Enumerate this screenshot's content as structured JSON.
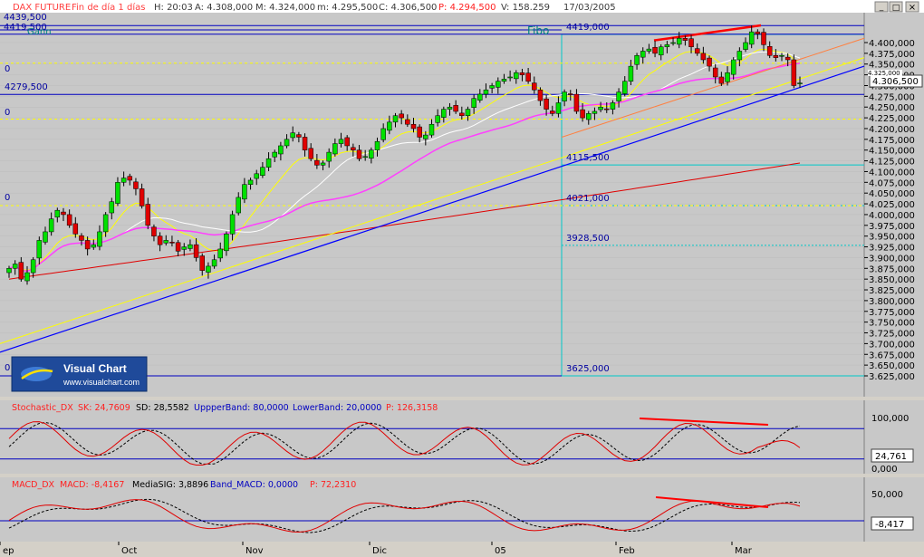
{
  "header": {
    "name": "DAX FUTURE",
    "period": "Fin de día 1 días",
    "H": "H: 20:03",
    "A": "A: 4.308,000",
    "M": "M: 4.324,000",
    "m": "m: 4.295,500",
    "C": "C: 4.306,500",
    "P": "P: 4.294,500",
    "V": "V: 158.259",
    "date": "17/03/2005"
  },
  "window_controls": {
    "minimize": "_",
    "restore": "□",
    "close": "×"
  },
  "logo": {
    "title": "Visual Chart",
    "url": "www.visualchart.com"
  },
  "gann_label": "Gann",
  "fibo_label": "Fibo",
  "price_axis": {
    "ticks": [
      "4.400,000",
      "4.375,000",
      "4.350,000",
      "4.325,000",
      "4.300,000",
      "4.275,000",
      "4.250,000",
      "4.225,000",
      "4.200,000",
      "4.175,000",
      "4.150,000",
      "4.125,000",
      "4.100,000",
      "4.075,000",
      "4.050,000",
      "4.025,000",
      "4.000,000",
      "3.975,000",
      "3.950,000",
      "3.925,000",
      "3.900,000",
      "3.875,000",
      "3.850,000",
      "3.825,000",
      "3.800,000",
      "3.775,000",
      "3.750,000",
      "3.725,000",
      "3.700,000",
      "3.675,000",
      "3.650,000",
      "3.625,000"
    ],
    "current_price": "4.306,500",
    "covered_label": "4.325,000"
  },
  "left_levels": [
    "4439,500",
    "4419,500",
    "4279,500"
  ],
  "left_clipped": [
    "0",
    "0",
    "0",
    "0"
  ],
  "fib_labels": [
    "4419,000",
    "4115,500",
    "4021,000",
    "3928,500",
    "3625,000"
  ],
  "stochastic": {
    "header": {
      "name": "Stochastic_DX",
      "SK": "SK: 24,7609",
      "SD": "SD: 28,5582",
      "upper": "UppperBand: 80,0000",
      "lower": "LowerBand: 20,0000",
      "P": "P: 126,3158"
    },
    "axis": [
      "100,000",
      "0,000"
    ],
    "current": "24,761"
  },
  "macd": {
    "header": {
      "name": "MACD_DX",
      "MACD": "MACD: -8,4167",
      "sig": "MediaSIG: 3,8896",
      "band": "Band_MACD: 0,0000",
      "P": "P: 72,2310"
    },
    "axis_top": "50,000",
    "current": "-8,417"
  },
  "x_axis": [
    "ep",
    "Oct",
    "Nov",
    "Dic",
    "05",
    "Feb",
    "Mar"
  ],
  "colors": {
    "background": "#c8c8c8",
    "up_candle": "#00e000",
    "down_candle": "#e00000",
    "ma_white": "#ffffff",
    "ma_yellow": "#ffff00",
    "ma_magenta": "#ff40ff",
    "ma_red": "#e00000",
    "trendline": "#0000ff",
    "fib_lines": "#00c8c8"
  },
  "chart_data": {
    "type": "candlestick",
    "title": "DAX FUTURE",
    "x": [
      "Sep",
      "Oct",
      "Nov",
      "Dic",
      "05",
      "Feb",
      "Mar"
    ],
    "ylim": [
      3610,
      4450
    ],
    "series": [
      {
        "values": [
          3875,
          3885,
          3850,
          3865,
          3895,
          3940,
          3960,
          3990,
          4010,
          4000,
          3975,
          3955,
          3940,
          3920,
          3930,
          3960,
          4000,
          4030,
          4075,
          4085,
          4080,
          4060,
          4020,
          3975,
          3950,
          3930,
          3940,
          3935,
          3915,
          3925,
          3930,
          3900,
          3870,
          3880,
          3895,
          3920,
          3955,
          4000,
          4040,
          4070,
          4080,
          4095,
          4110,
          4130,
          4145,
          4160,
          4175,
          4190,
          4180,
          4150,
          4130,
          4115,
          4120,
          4145,
          4165,
          4175,
          4160,
          4150,
          4130,
          4135,
          4150,
          4170,
          4200,
          4215,
          4230,
          4225,
          4210,
          4200,
          4180,
          4185,
          4210,
          4230,
          4245,
          4250,
          4240,
          4230,
          4245,
          4270,
          4280,
          4290,
          4300,
          4310,
          4315,
          4320,
          4330,
          4325,
          4310,
          4290,
          4265,
          4245,
          4235,
          4260,
          4285,
          4280,
          4240,
          4225,
          4235,
          4240,
          4250,
          4245,
          4260,
          4285,
          4310,
          4345,
          4370,
          4380,
          4385,
          4375,
          4390,
          4395,
          4400,
          4410,
          4405,
          4390,
          4375,
          4360,
          4345,
          4320,
          4305,
          4330,
          4360,
          4380,
          4400,
          4425,
          4420,
          4395,
          4370,
          4365,
          4370,
          4360,
          4300,
          4306
        ]
      },
      {
        "name": "MA white"
      },
      {
        "name": "MA yellow"
      },
      {
        "name": "MA magenta"
      },
      {
        "name": "MA red"
      }
    ],
    "levels": [
      4439.5,
      4419.5,
      4279.5,
      4419.0,
      4115.5,
      4021.0,
      3928.5,
      3625.0
    ],
    "stochastic": {
      "upper": 80,
      "lower": 20,
      "last": 24.7609
    },
    "macd": {
      "last": -8.4167,
      "signal": 3.8896
    }
  }
}
